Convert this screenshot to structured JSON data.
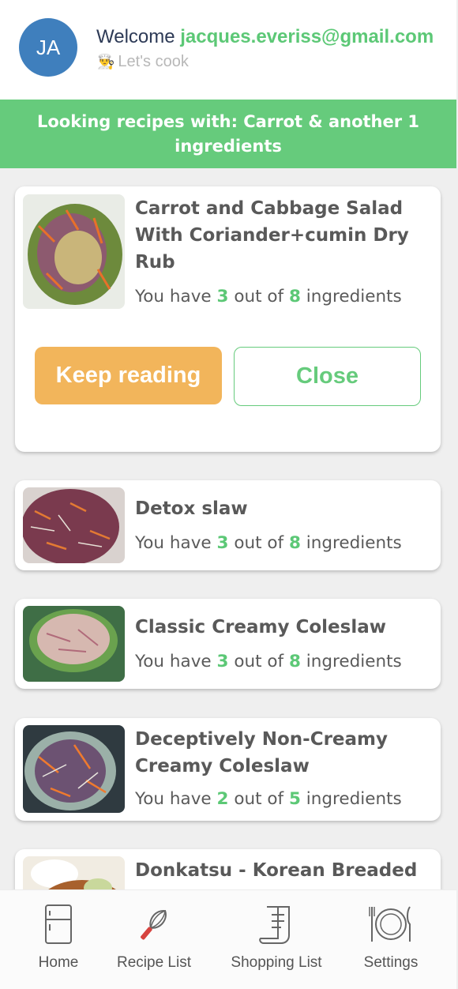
{
  "header": {
    "avatar_initials": "JA",
    "welcome_prefix": "Welcome",
    "email": "jacques.everiss@gmail.com",
    "subtitle_icon": "chef-icon",
    "subtitle": "Let's cook"
  },
  "banner": {
    "text": "Looking recipes with: Carrot & another 1 ingredients"
  },
  "stats_text": {
    "prefix": "You have",
    "middle": "out of",
    "suffix": "ingredients"
  },
  "recipes": [
    {
      "title": "Carrot and Cabbage Salad With Coriander+cumin Dry Rub",
      "have": "3",
      "total": "8",
      "expanded": true
    },
    {
      "title": "Detox slaw",
      "have": "3",
      "total": "8"
    },
    {
      "title": "Classic Creamy Coleslaw",
      "have": "3",
      "total": "8"
    },
    {
      "title": "Deceptively Non-Creamy Creamy Coleslaw",
      "have": "2",
      "total": "5"
    },
    {
      "title": "Donkatsu - Korean Breaded"
    }
  ],
  "card_actions": {
    "keep_reading": "Keep reading",
    "close": "Close"
  },
  "bottom_nav": [
    {
      "label": "Home",
      "icon": "fridge-icon"
    },
    {
      "label": "Recipe List",
      "icon": "whisk-icon"
    },
    {
      "label": "Shopping List",
      "icon": "receipt-icon"
    },
    {
      "label": "Settings",
      "icon": "plate-cutlery-icon"
    }
  ],
  "colors": {
    "accent_green": "#66cb7c",
    "avatar_blue": "#3f7fbd",
    "button_orange": "#f2b55b"
  }
}
